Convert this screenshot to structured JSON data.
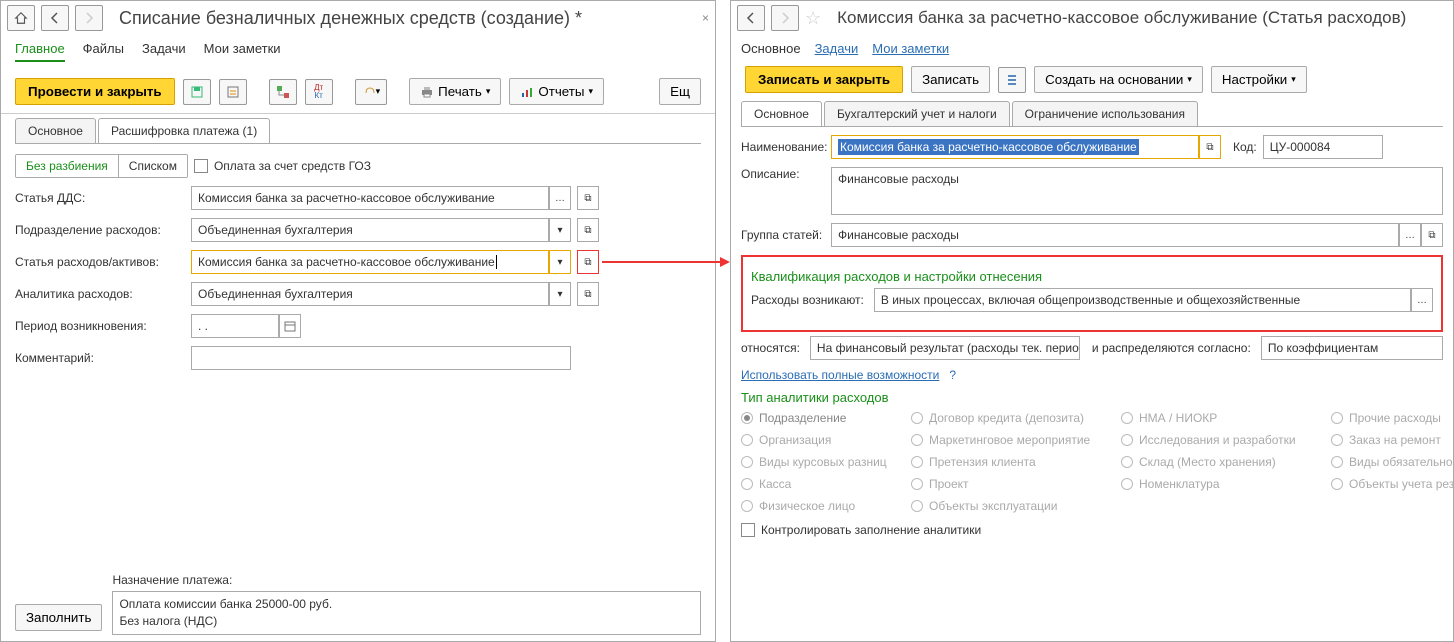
{
  "left": {
    "title": "Списание безналичных денежных средств (создание) *",
    "nav": {
      "main": "Главное",
      "files": "Файлы",
      "tasks": "Задачи",
      "notes": "Мои заметки"
    },
    "toolbar": {
      "post_close": "Провести и закрыть",
      "print": "Печать",
      "reports": "Отчеты",
      "more": "Ещ"
    },
    "tabs": {
      "main": "Основное",
      "breakdown": "Расшифровка платежа (1)"
    },
    "seg": {
      "no_split": "Без разбиения",
      "list": "Списком"
    },
    "goz_label": "Оплата за счет средств ГОЗ",
    "fields": {
      "dds_label": "Статья ДДС:",
      "dds_value": "Комиссия банка за расчетно-кассовое обслуживание",
      "dept_label": "Подразделение расходов:",
      "dept_value": "Объединенная бухгалтерия",
      "exp_label": "Статья расходов/активов:",
      "exp_value": "Комиссия банка за расчетно-кассовое обслуживание",
      "anal_label": "Аналитика расходов:",
      "anal_value": "Объединенная бухгалтерия",
      "period_label": "Период возникновения:",
      "period_value": "  .  .    ",
      "comment_label": "Комментарий:",
      "purpose_label": "Назначение платежа:",
      "purpose_line1": "Оплата комиссии банка 25000-00 руб.",
      "purpose_line2": "Без налога (НДС)"
    },
    "fill_btn": "Заполнить"
  },
  "right": {
    "title": "Комиссия банка за расчетно-кассовое обслуживание (Статья расходов)",
    "nav": {
      "main": "Основное",
      "tasks": "Задачи",
      "notes": "Мои заметки"
    },
    "toolbar": {
      "save_close": "Записать и закрыть",
      "save": "Записать",
      "create_based": "Создать на основании",
      "settings": "Настройки"
    },
    "tabs": {
      "main": "Основное",
      "acct": "Бухгалтерский учет и налоги",
      "limit": "Ограничение использования"
    },
    "fields": {
      "name_label": "Наименование:",
      "name_value": "Комиссия банка за расчетно-кассовое обслуживание",
      "code_label": "Код:",
      "code_value": "ЦУ-000084",
      "desc_label": "Описание:",
      "desc_value": "Финансовые расходы",
      "group_label": "Группа статей:",
      "group_value": "Финансовые расходы"
    },
    "qualification": {
      "header": "Квалификация расходов и настройки отнесения",
      "arise_label": "Расходы возникают:",
      "arise_value": "В иных процессах, включая общепроизводственные и общехозяйственные",
      "relate_label": "относятся:",
      "relate_value": "На финансовый результат (расходы тек. перио,",
      "distrib_label": "и распределяются согласно:",
      "distrib_value": "По коэффициентам"
    },
    "full_link": "Использовать полные возможности",
    "anal_header": "Тип аналитики расходов",
    "radios": {
      "dept": "Подразделение",
      "org": "Организация",
      "rates": "Виды курсовых разниц",
      "cash": "Касса",
      "person": "Физическое лицо",
      "contract": "Договор кредита (депозита)",
      "marketing": "Маркетинговое мероприятие",
      "claim": "Претензия клиента",
      "project": "Проект",
      "assets": "Объекты эксплуатации",
      "nma": "НМА / НИОКР",
      "research": "Исследования и разработки",
      "warehouse": "Склад (Место хранения)",
      "nomen": "Номенклатура",
      "other": "Прочие расходы",
      "repair": "Заказ на ремонт",
      "mandatory": "Виды обязательного стр",
      "reserves": "Объекты учета резервов"
    },
    "control_check": "Контролировать заполнение аналитики"
  }
}
